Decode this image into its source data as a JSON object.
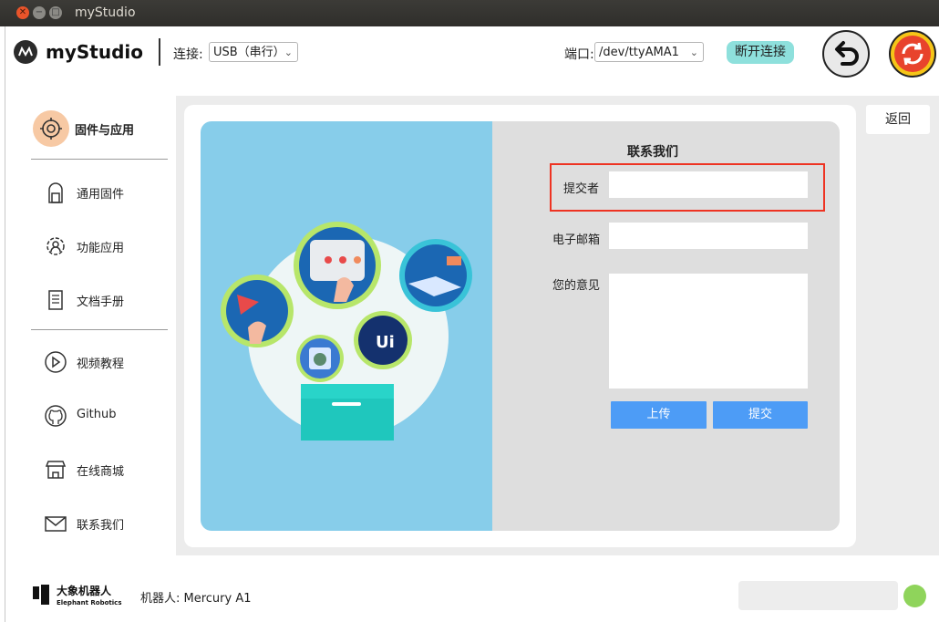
{
  "window": {
    "title": "myStudio"
  },
  "header": {
    "app_name": "myStudio",
    "connect_label": "连接:",
    "connect_value": "USB（串行）",
    "port_label": "端口:",
    "port_value": "/dev/ttyAMA1",
    "disconnect_label": "断开连接"
  },
  "sidebar": {
    "items": [
      {
        "label": "固件与应用",
        "icon": "firmware-app-icon"
      },
      {
        "label": "通用固件",
        "icon": "firmware-icon"
      },
      {
        "label": "功能应用",
        "icon": "gear-person-icon"
      },
      {
        "label": "文档手册",
        "icon": "document-icon"
      },
      {
        "label": "视频教程",
        "icon": "play-icon"
      },
      {
        "label": "Github",
        "icon": "github-icon"
      },
      {
        "label": "在线商城",
        "icon": "store-icon"
      },
      {
        "label": "联系我们",
        "icon": "mail-icon"
      }
    ]
  },
  "form": {
    "title": "联系我们",
    "submitter_label": "提交者",
    "submitter_value": "",
    "email_label": "电子邮箱",
    "email_value": "",
    "feedback_label": "您的意见",
    "feedback_value": "",
    "upload_label": "上传",
    "submit_label": "提交"
  },
  "back_label": "返回",
  "footer": {
    "company_cn": "大象机器人",
    "company_en": "Elephant Robotics",
    "robot_label": "机器人: Mercury A1"
  },
  "colors": {
    "accent_teal": "#8ee0dc",
    "button_blue": "#4d9cf6",
    "status_green": "#8fd45b",
    "highlight_red": "#ee3322",
    "illustration_bg": "#87cdea"
  }
}
